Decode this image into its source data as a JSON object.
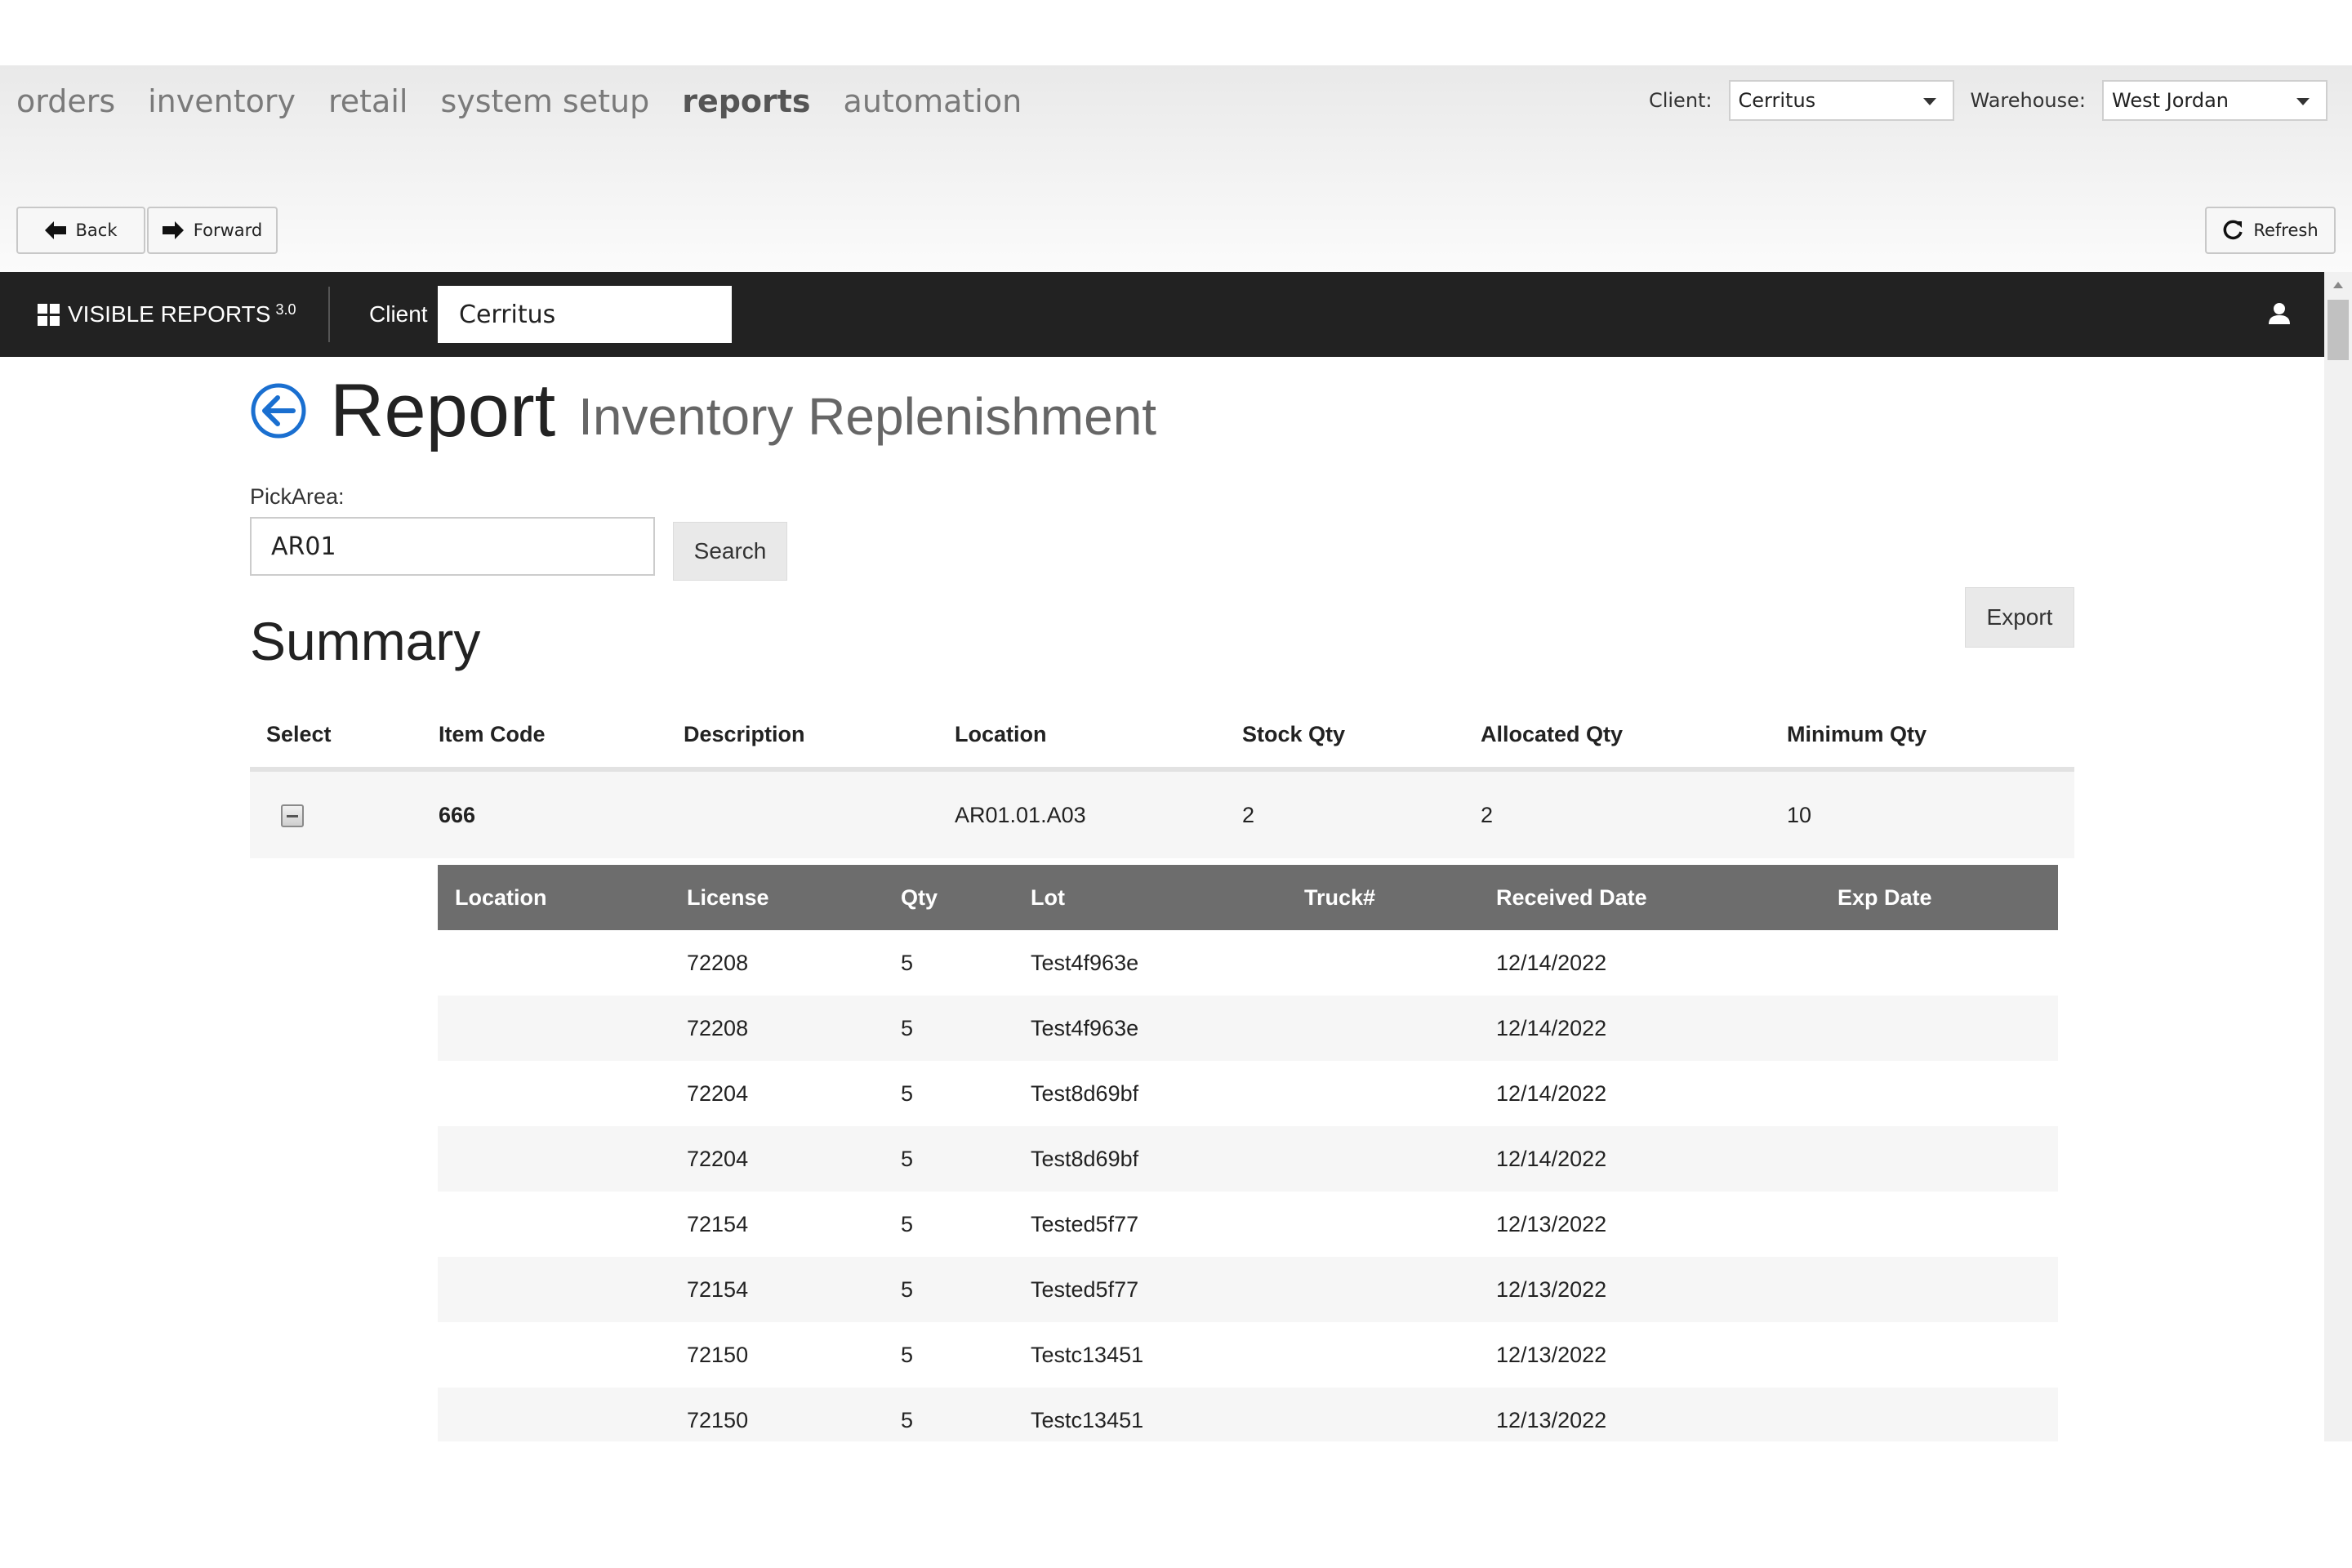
{
  "nav": {
    "items": [
      {
        "label": "orders"
      },
      {
        "label": "inventory"
      },
      {
        "label": "retail"
      },
      {
        "label": "system setup"
      },
      {
        "label": "reports"
      },
      {
        "label": "automation"
      }
    ],
    "active": "reports"
  },
  "selectors": {
    "client_label": "Client:",
    "client_value": "Cerritus",
    "warehouse_label": "Warehouse:",
    "warehouse_value": "West Jordan"
  },
  "toolbar": {
    "back_label": "Back",
    "forward_label": "Forward",
    "refresh_label": "Refresh"
  },
  "visible_reports": {
    "brand": "VISIBLE REPORTS",
    "version": "3.0",
    "client_label": "Client",
    "client_value": "Cerritus"
  },
  "report": {
    "title": "Report",
    "subtitle": "Inventory Replenishment",
    "pick_area_label": "PickArea:",
    "pick_area_value": "AR01",
    "search_label": "Search",
    "export_label": "Export",
    "summary_title": "Summary"
  },
  "summary_table": {
    "columns": [
      "Select",
      "Item Code",
      "Description",
      "Location",
      "Stock Qty",
      "Allocated Qty",
      "Minimum Qty"
    ],
    "rows": [
      {
        "item_code": "666",
        "description": "",
        "location": "AR01.01.A03",
        "stock_qty": "2",
        "allocated_qty": "2",
        "minimum_qty": "10"
      }
    ]
  },
  "detail_table": {
    "columns": [
      "Location",
      "License",
      "Qty",
      "Lot",
      "Truck#",
      "Received Date",
      "Exp Date"
    ],
    "rows": [
      {
        "location": "",
        "license": "72208",
        "qty": "5",
        "lot": "Test4f963e",
        "truck": "",
        "received": "12/14/2022",
        "exp": ""
      },
      {
        "location": "",
        "license": "72208",
        "qty": "5",
        "lot": "Test4f963e",
        "truck": "",
        "received": "12/14/2022",
        "exp": ""
      },
      {
        "location": "",
        "license": "72204",
        "qty": "5",
        "lot": "Test8d69bf",
        "truck": "",
        "received": "12/14/2022",
        "exp": ""
      },
      {
        "location": "",
        "license": "72204",
        "qty": "5",
        "lot": "Test8d69bf",
        "truck": "",
        "received": "12/14/2022",
        "exp": ""
      },
      {
        "location": "",
        "license": "72154",
        "qty": "5",
        "lot": "Tested5f77",
        "truck": "",
        "received": "12/13/2022",
        "exp": ""
      },
      {
        "location": "",
        "license": "72154",
        "qty": "5",
        "lot": "Tested5f77",
        "truck": "",
        "received": "12/13/2022",
        "exp": ""
      },
      {
        "location": "",
        "license": "72150",
        "qty": "5",
        "lot": "Testc13451",
        "truck": "",
        "received": "12/13/2022",
        "exp": ""
      },
      {
        "location": "",
        "license": "72150",
        "qty": "5",
        "lot": "Testc13451",
        "truck": "",
        "received": "12/13/2022",
        "exp": ""
      }
    ]
  },
  "colors": {
    "dark_bar": "#222222",
    "table_header": "#6d6d6d",
    "accent_blue": "#1a6fd0"
  }
}
